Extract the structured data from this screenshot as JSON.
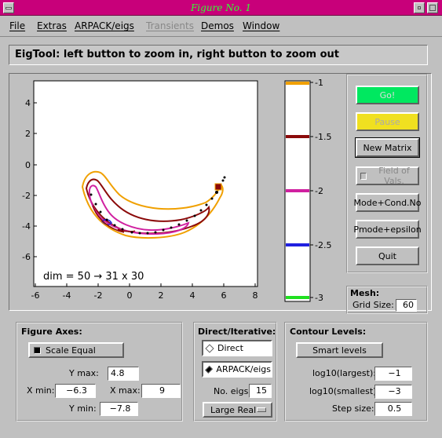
{
  "window": {
    "title": "Figure No. 1"
  },
  "menu": [
    "File",
    "Extras",
    "ARPACK/eigs",
    "Transients",
    "Demos",
    "Window"
  ],
  "banner": "EigTool: left button to zoom in, right button to zoom out",
  "plot": {
    "xticks": [
      "-6",
      "-4",
      "-2",
      "0",
      "2",
      "4",
      "6",
      "8"
    ],
    "yticks": [
      "4",
      "2",
      "0",
      "-2",
      "-4",
      "-6"
    ],
    "annotation": "dim = 50 → 31 x 30"
  },
  "colorbar": {
    "ticks": [
      "-1",
      "-1.5",
      "-2",
      "-2.5",
      "-3"
    ],
    "colors": [
      "#f0a000",
      "#8b0a0a",
      "#d020a0",
      "#2020e0",
      "#20e020"
    ]
  },
  "buttons": {
    "go": "Go!",
    "pause": "Pause",
    "new_matrix": "New Matrix",
    "field_of_vals": "Field of Vals.",
    "mode_cond": "Mode+Cond.No",
    "pmode": "Pmode+epsilon",
    "quit": "Quit"
  },
  "mesh": {
    "title": "Mesh:",
    "grid_label": "Grid Size:",
    "grid_value": "60"
  },
  "figure_axes": {
    "title": "Figure Axes:",
    "scale_equal": "Scale Equal",
    "ymax_label": "Y max:",
    "ymax": "4.8",
    "xmin_label": "X min:",
    "xmin": "−6.3",
    "xmax_label": "X max:",
    "xmax": "9",
    "ymin_label": "Y min:",
    "ymin": "−7.8"
  },
  "direct_iterative": {
    "title": "Direct/Iterative:",
    "direct": "Direct",
    "arpack": "ARPACK/eigs",
    "noeigs_label": "No. eigs",
    "noeigs": "15",
    "which": "Large Real"
  },
  "contour": {
    "title": "Contour Levels:",
    "smart": "Smart  levels",
    "largest_label": "log10(largest):",
    "largest": "−1",
    "smallest_label": "log10(smallest):",
    "smallest": "−3",
    "step_label": "Step size:",
    "step": "0.5"
  }
}
